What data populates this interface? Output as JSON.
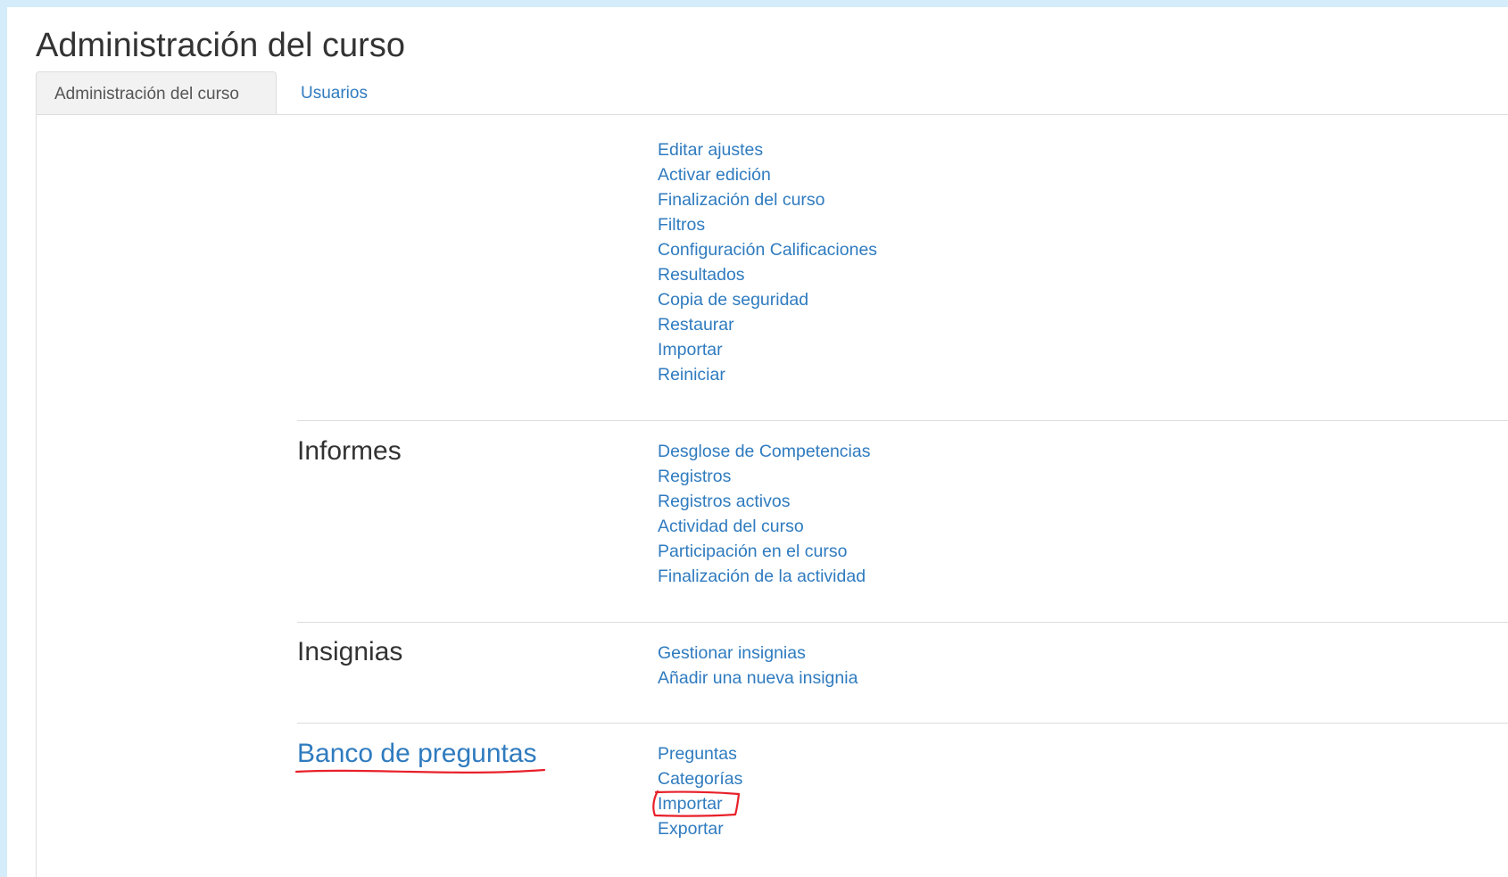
{
  "page": {
    "title": "Administración del curso"
  },
  "tabs": [
    {
      "label": "Administración del curso",
      "active": true
    },
    {
      "label": "Usuarios",
      "active": false
    }
  ],
  "sections": {
    "course": {
      "heading": "",
      "links": [
        "Editar ajustes",
        "Activar edición",
        "Finalización del curso",
        "Filtros",
        "Configuración Calificaciones",
        "Resultados",
        "Copia de seguridad",
        "Restaurar",
        "Importar",
        "Reiniciar"
      ]
    },
    "reports": {
      "heading": "Informes",
      "links": [
        "Desglose de Competencias",
        "Registros",
        "Registros activos",
        "Actividad del curso",
        "Participación en el curso",
        "Finalización de la actividad"
      ]
    },
    "badges": {
      "heading": "Insignias",
      "links": [
        "Gestionar insignias",
        "Añadir una nueva insignia"
      ]
    },
    "question_bank": {
      "heading": "Banco de preguntas",
      "links": [
        "Preguntas",
        "Categorías",
        "Importar",
        "Exportar"
      ]
    }
  },
  "colors": {
    "link": "#2f7bbf",
    "text": "#333333",
    "annotation": "#e8202a",
    "background_frame": "#d5ecfb"
  }
}
